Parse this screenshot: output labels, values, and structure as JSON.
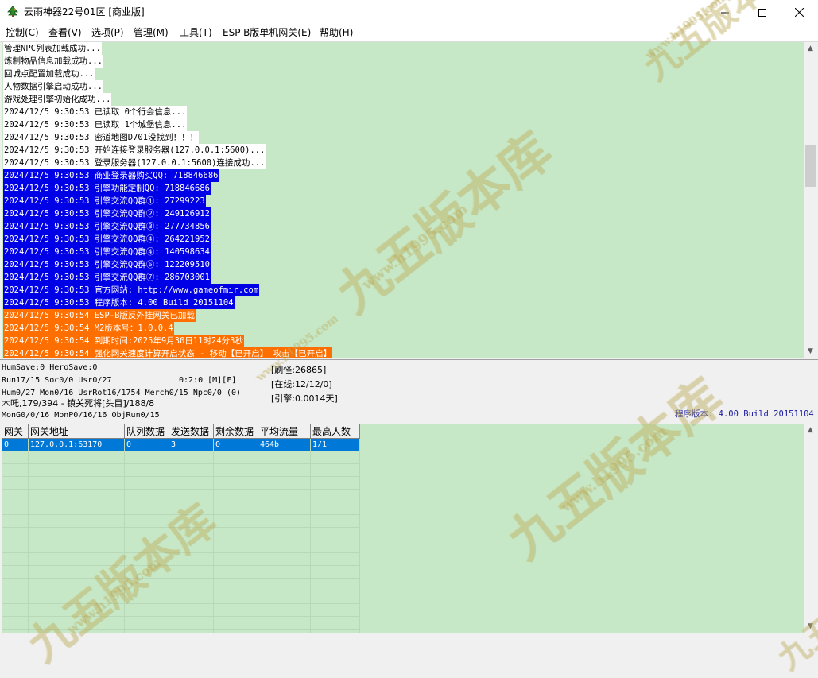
{
  "window": {
    "title": "云雨神器22号01区 [商业版]",
    "icon": "tree-icon",
    "controls": [
      "minimize",
      "maximize",
      "close"
    ]
  },
  "menu": [
    "控制(C)",
    "查看(V)",
    "选项(P)",
    "管理(M)",
    "工具(T)",
    "ESP-B版单机网关(E)",
    "帮助(H)"
  ],
  "log_lines": [
    {
      "text": "管理NPC列表加载成功...",
      "style": "plain"
    },
    {
      "text": "炼制物品信息加载成功...",
      "style": "plain"
    },
    {
      "text": "回城点配置加载成功...",
      "style": "plain"
    },
    {
      "text": "人物数据引擎启动成功...",
      "style": "plain"
    },
    {
      "text": "游戏处理引擎初始化成功...",
      "style": "plain"
    },
    {
      "text": "2024/12/5 9:30:53 已读取 0个行会信息...",
      "style": "plain"
    },
    {
      "text": "2024/12/5 9:30:53 已读取 1个城堡信息...",
      "style": "plain"
    },
    {
      "text": "2024/12/5 9:30:53 密道地图D701没找到！！！",
      "style": "plain"
    },
    {
      "text": "2024/12/5 9:30:53 开始连接登录服务器(127.0.0.1:5600)...",
      "style": "plain"
    },
    {
      "text": "2024/12/5 9:30:53 登录服务器(127.0.0.1:5600)连接成功...",
      "style": "plain"
    },
    {
      "text": "2024/12/5 9:30:53 商业登录器购买QQ: 718846686",
      "style": "blue"
    },
    {
      "text": "2024/12/5 9:30:53 引擎功能定制QQ: 718846686",
      "style": "blue"
    },
    {
      "text": "2024/12/5 9:30:53 引擎交流QQ群①: 27299223",
      "style": "blue"
    },
    {
      "text": "2024/12/5 9:30:53 引擎交流QQ群②: 249126912",
      "style": "blue"
    },
    {
      "text": "2024/12/5 9:30:53 引擎交流QQ群③: 277734856",
      "style": "blue"
    },
    {
      "text": "2024/12/5 9:30:53 引擎交流QQ群④: 264221952",
      "style": "blue"
    },
    {
      "text": "2024/12/5 9:30:53 引擎交流QQ群④: 140598634",
      "style": "blue"
    },
    {
      "text": "2024/12/5 9:30:53 引擎交流QQ群⑥: 122209510",
      "style": "blue"
    },
    {
      "text": "2024/12/5 9:30:53 引擎交流QQ群⑦: 286703001",
      "style": "blue"
    },
    {
      "text": "2024/12/5 9:30:53 官方网站: http://www.gameofmir.com",
      "style": "blue"
    },
    {
      "text": "2024/12/5 9:30:53 程序版本: 4.00 Build 20151104",
      "style": "blue"
    },
    {
      "text": "2024/12/5 9:30:54 ESP-B版反外挂网关已加载",
      "style": "orange"
    },
    {
      "text": "2024/12/5 9:30:54 M2版本号：1.0.0.4",
      "style": "orange"
    },
    {
      "text": "2024/12/5 9:30:54 到期时间:2025年9月30日11时24分3秒",
      "style": "orange"
    },
    {
      "text": "2024/12/5 9:30:54 强化网关速度计算开启状态 - 移动【已开启】 攻击【已开启】",
      "style": "orange"
    }
  ],
  "status": {
    "line1": "HumSave:0 HeroSave:0",
    "line2": "Run17/15 Soc0/0 Usr0/27",
    "line2b": "0:2:0 [M][F]",
    "line3": "Hum0/27 Mon0/16 UsrRot16/1754 Merch0/15 Npc0/0 (0)",
    "line4": "木吒,179/394 - 镇关死将[头目]/188/8",
    "line5": "MonG0/0/16 MonP0/16/16 ObjRun0/15",
    "refresh": "[刷怪:26865]",
    "online": "[在线:12/12/0]",
    "engine": "[引擎:0.0014天]",
    "version": "程序版本: 4.00 Build 20151104"
  },
  "gateway_table": {
    "columns": [
      "网关",
      "网关地址",
      "队列数据",
      "发送数据",
      "剩余数据",
      "平均流量",
      "最高人数"
    ],
    "rows": [
      [
        "0",
        "127.0.0.1:63170",
        "0",
        "3",
        "0",
        "464b",
        "1/1"
      ]
    ],
    "selected_row": 0
  },
  "watermark": {
    "text": "九五版本库",
    "url": "www.h1995.com"
  }
}
